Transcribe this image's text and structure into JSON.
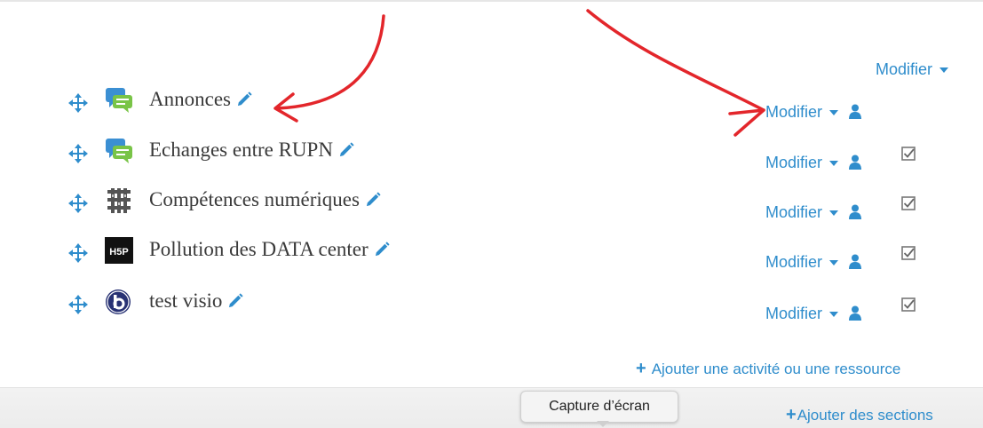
{
  "section": {
    "edit_label": "Modifier"
  },
  "activities": [
    {
      "name": "Annonces",
      "icon": "forum-icon",
      "modifier_label": "Modifier",
      "has_checkbox": false
    },
    {
      "name": "Echanges entre RUPN",
      "icon": "forum-icon",
      "modifier_label": "Modifier",
      "has_checkbox": true
    },
    {
      "name": "Compétences numériques",
      "icon": "glossary-icon",
      "modifier_label": "Modifier",
      "has_checkbox": true
    },
    {
      "name": "Pollution des DATA center",
      "icon": "h5p-icon",
      "modifier_label": "Modifier",
      "has_checkbox": true
    },
    {
      "name": "test visio",
      "icon": "bigbluebutton-icon",
      "modifier_label": "Modifier",
      "has_checkbox": true
    }
  ],
  "actions": {
    "add_activity_label": "Ajouter une activité ou une ressource",
    "add_sections_label": "Ajouter des sections"
  },
  "tooltip": {
    "text": "Capture d’écran"
  },
  "h5p_icon_text": "H5P",
  "colors": {
    "link": "#2f8dcc",
    "annotation": "#e3262b",
    "forum_green": "#79c447",
    "forum_blue": "#3b8fd3"
  }
}
